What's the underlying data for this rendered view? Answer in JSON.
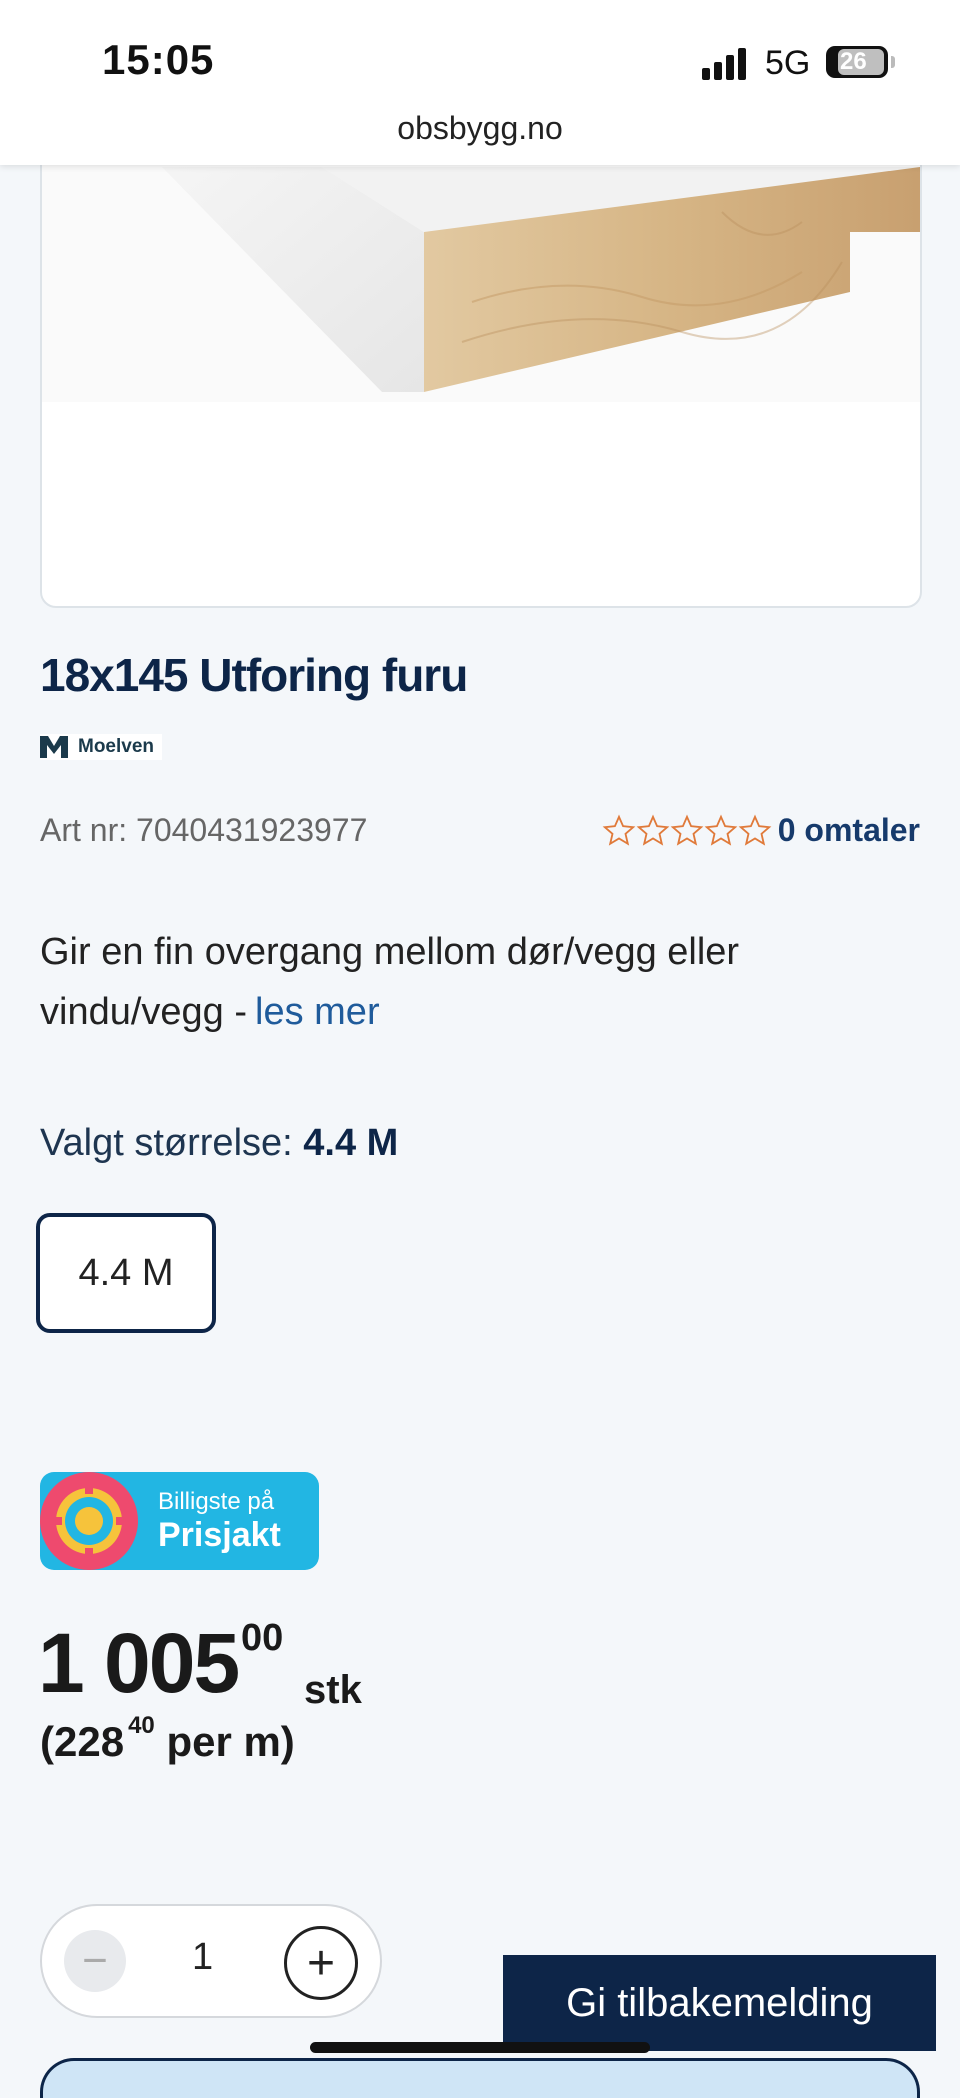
{
  "status_bar": {
    "time": "15:05",
    "network": "5G",
    "battery": "26",
    "url": "obsbygg.no"
  },
  "product": {
    "title": "18x145 Utforing furu",
    "brand": "Moelven",
    "art_nr": "Art nr: 7040431923977",
    "rating_stars": 0,
    "reviews": "0 omtaler",
    "description": "Gir en fin overgang mellom dør/vegg eller vindu/vegg -",
    "read_more": "les mer"
  },
  "size": {
    "label": "Valgt størrelse:",
    "selected": "4.4 M",
    "options": [
      "4.4 M"
    ]
  },
  "badge": {
    "line1": "Billigste på",
    "line2": "Prisjakt"
  },
  "price": {
    "whole": "1 005",
    "decimals": "00",
    "unit": "stk",
    "per_unit_open": "(228",
    "per_unit_decimals": "40",
    "per_unit_close": "per m)"
  },
  "quantity": {
    "minus": "−",
    "value": "1",
    "plus": "+"
  },
  "feedback_button": "Gi tilbakemelding",
  "colors": {
    "navy": "#0d2548",
    "link": "#1f5b9b",
    "star": "#e07a3a",
    "prisjakt": "#22b6e3"
  }
}
